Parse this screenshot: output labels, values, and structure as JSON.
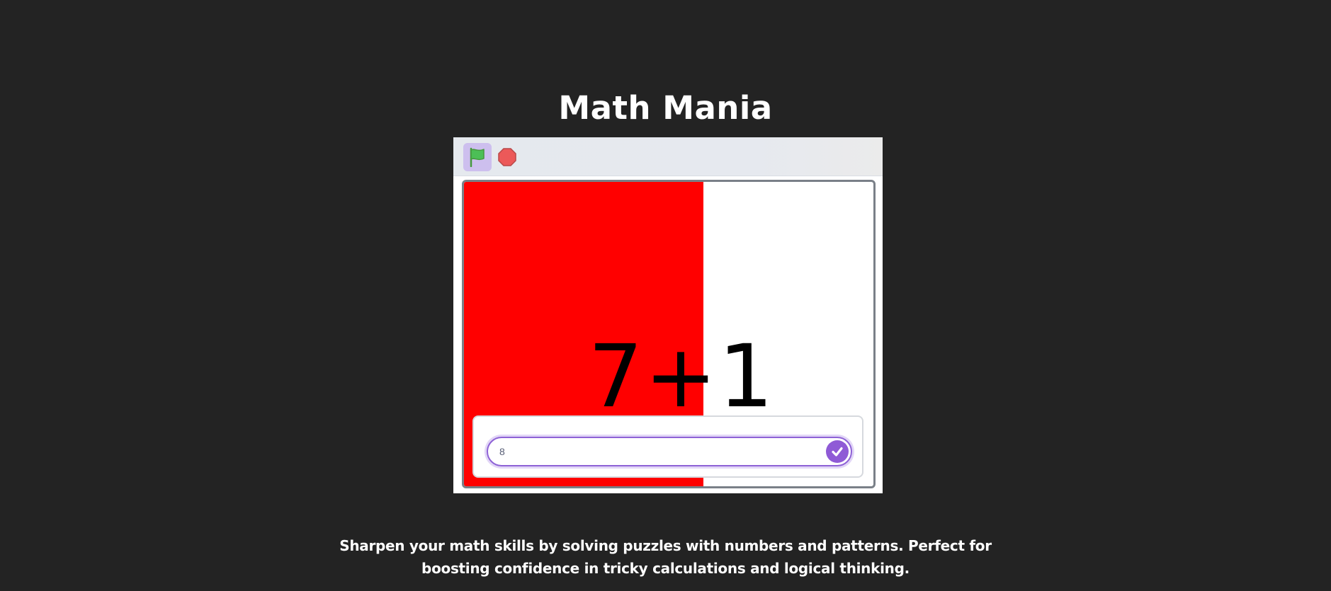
{
  "page": {
    "title": "Math Mania",
    "description_line1": "Sharpen your math skills by solving puzzles with numbers and patterns. Perfect for",
    "description_line2": "boosting confidence in tricky calculations and logical thinking."
  },
  "controls": {
    "green_flag_icon": "green-flag-icon",
    "stop_icon": "stop-sign-icon"
  },
  "stage": {
    "problem_text": "7+1",
    "answer_value": "8",
    "submit_icon": "check-icon"
  },
  "colors": {
    "background": "#232323",
    "stage_red": "#ff0000",
    "accent_purple": "#8f5ad6",
    "flag_green": "#4cbf56",
    "stop_red": "#ec5959"
  }
}
